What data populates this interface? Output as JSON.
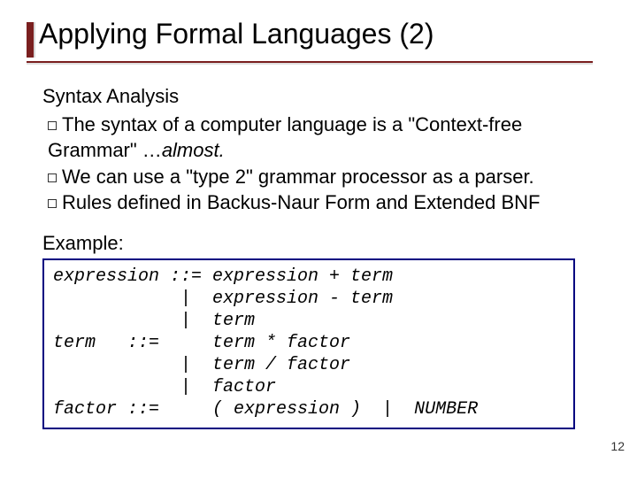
{
  "title": "Applying Formal Languages (2)",
  "section1": "Syntax Analysis",
  "bullets": {
    "b1a": "The syntax of a computer language is a \"Context-free",
    "b1b": "Grammar\" …",
    "b1b_em": "almost.",
    "b2": "We can use a \"type 2\" grammar processor as a parser.",
    "b3": "Rules defined in Backus-Naur Form and Extended BNF"
  },
  "example_label": "Example:",
  "code": "expression ::= expression + term\n            |  expression - term\n            |  term\nterm   ::=     term * factor\n            |  term / factor\n            |  factor\nfactor ::=     ( expression )  |  NUMBER",
  "page_number": "12"
}
